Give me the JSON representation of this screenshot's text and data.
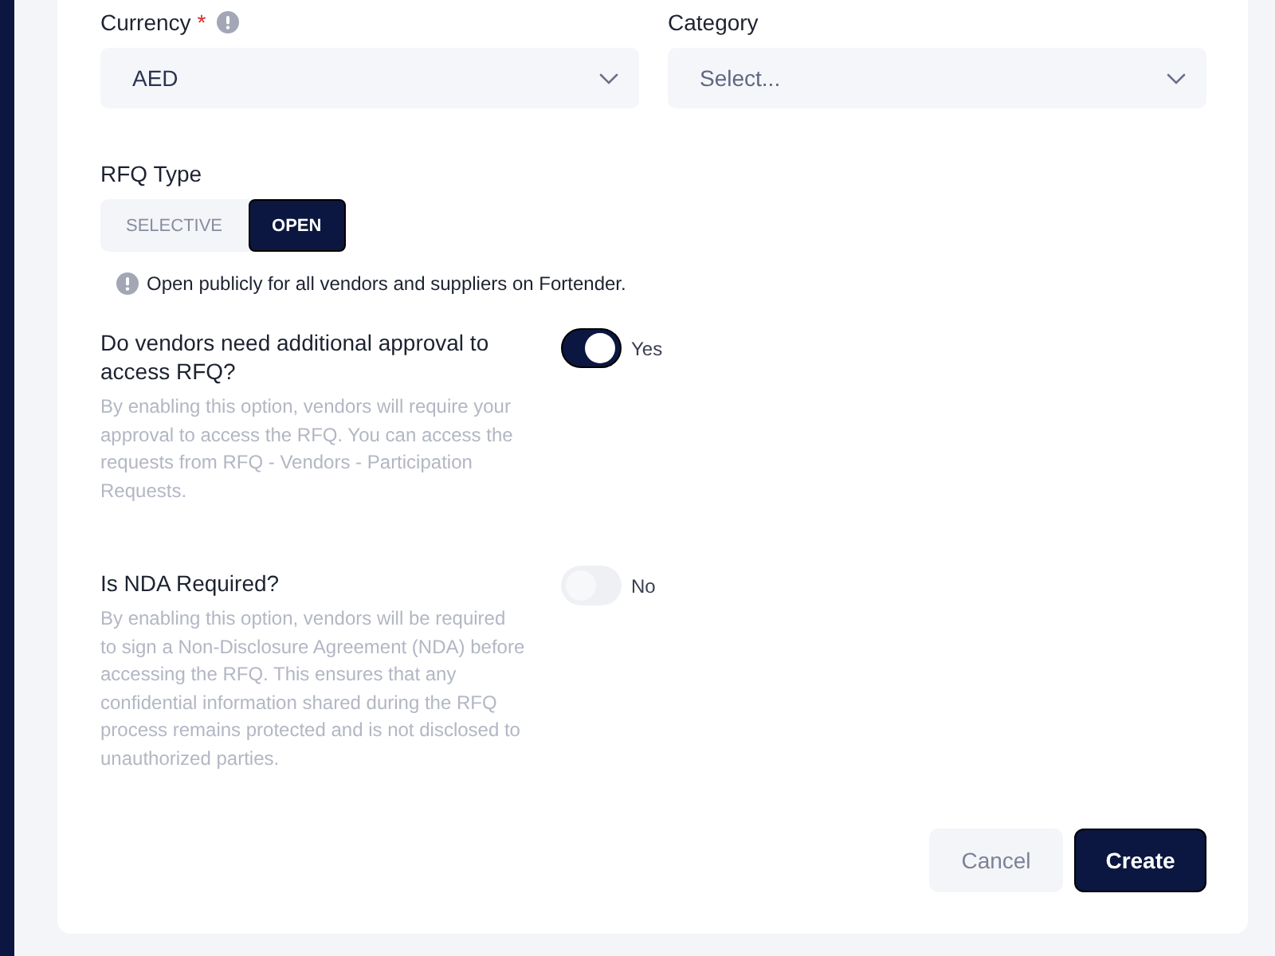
{
  "fields": [
    {
      "label": "Currency",
      "required_mark": "*",
      "info": true,
      "value": "AED"
    },
    {
      "label": "Category",
      "info": false,
      "placeholder": "Select..."
    }
  ],
  "rfq_type": {
    "label": "RFQ Type",
    "options": [
      {
        "label": "SELECTIVE",
        "selected": false
      },
      {
        "label": "OPEN",
        "selected": true
      }
    ],
    "note": "Open publicly for all vendors and suppliers on Fortender."
  },
  "questions": [
    {
      "title": "Do vendors need additional approval to access RFQ?",
      "description": "By enabling this option, vendors will require your approval to access the RFQ. You can access the requests from RFQ - Vendors - Participation Requests.",
      "on": true,
      "state_label": "Yes"
    },
    {
      "title": "Is NDA Required?",
      "description": "By enabling this option, vendors will be required to sign a Non-Disclosure Agreement (NDA) before accessing the RFQ. This ensures that any confidential information shared during the RFQ process remains protected and is not disclosed to unauthorized parties.",
      "on": false,
      "state_label": "No"
    }
  ],
  "buttons": [
    {
      "label": "Cancel",
      "kind": "secondary"
    },
    {
      "label": "Create",
      "kind": "primary"
    }
  ]
}
